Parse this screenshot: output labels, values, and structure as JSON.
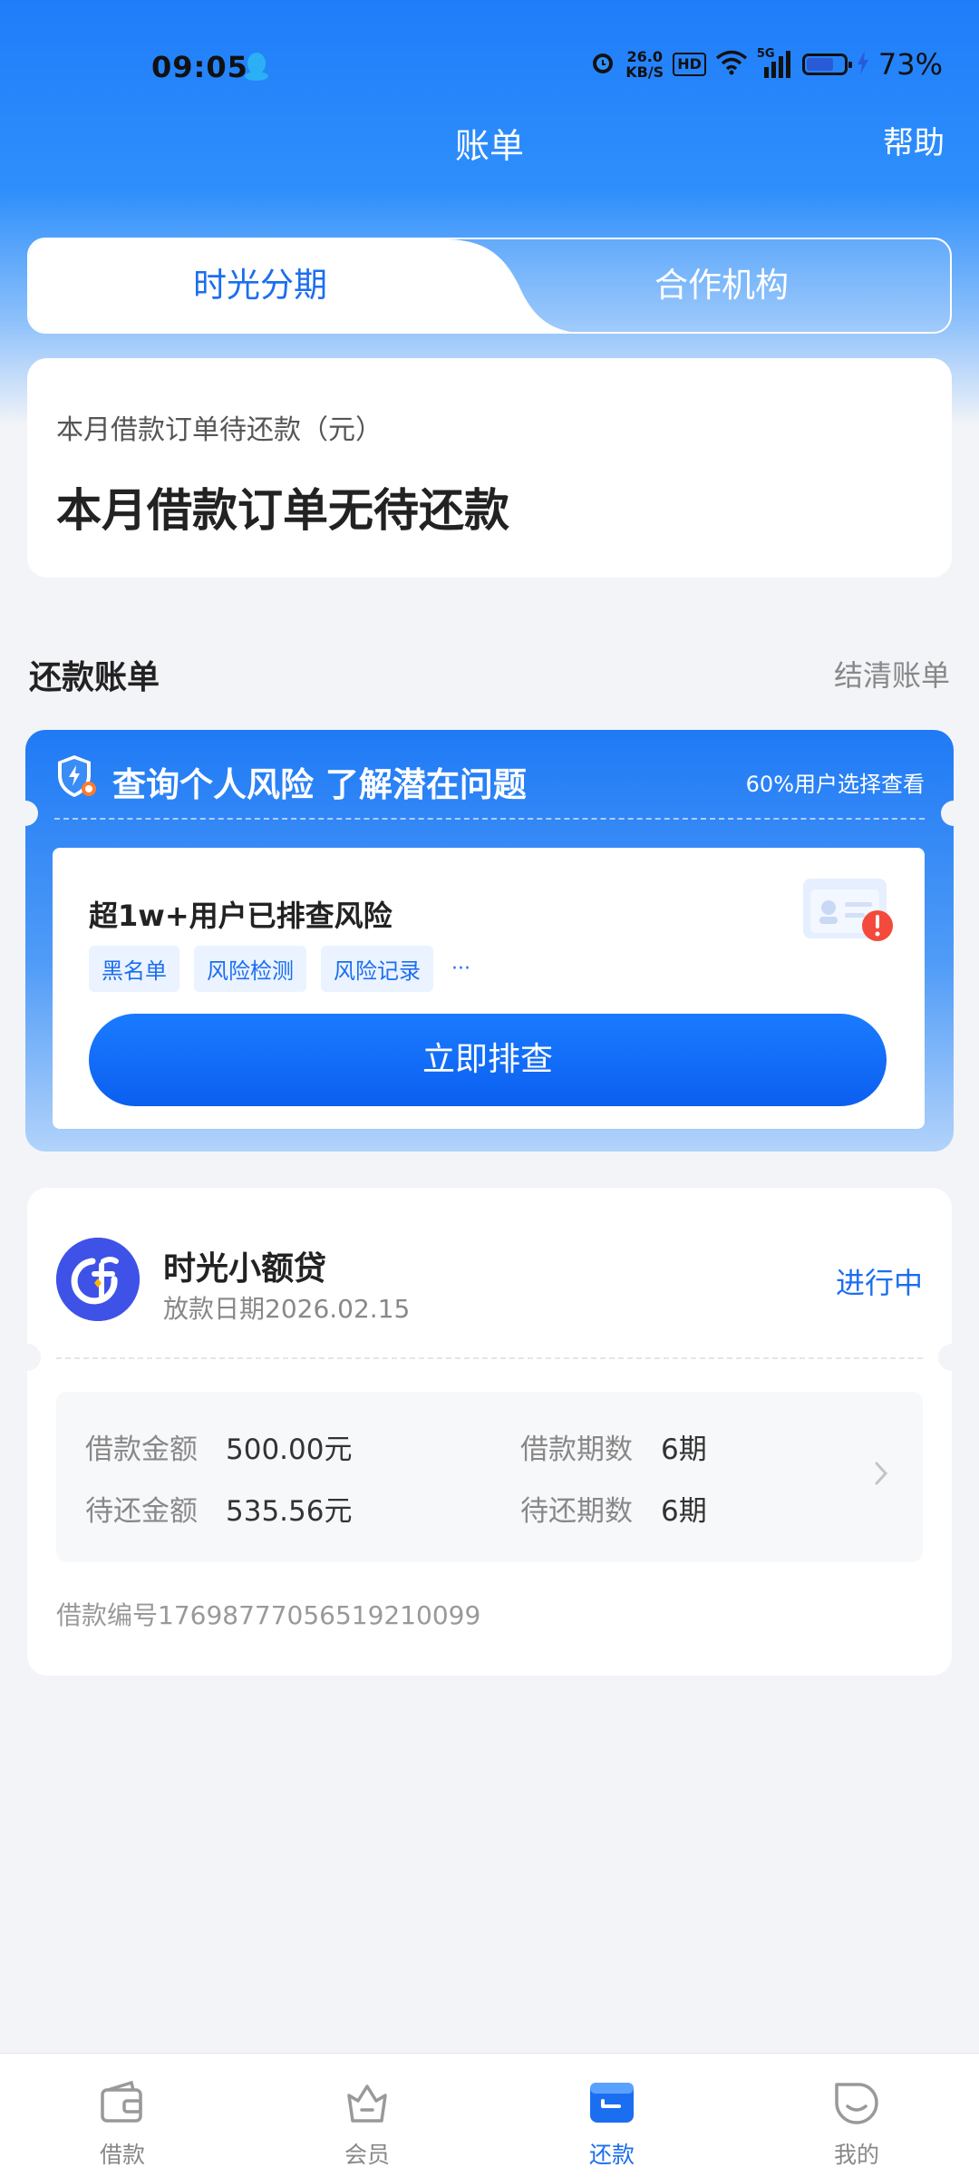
{
  "status_bar": {
    "time": "09:05",
    "net_speed": "26.0",
    "net_unit": "KB/S",
    "hd": "HD",
    "cellular": "5G",
    "battery_level": 0.73,
    "battery_percent": "73%"
  },
  "header": {
    "title": "账单",
    "help": "帮助"
  },
  "tabs": [
    {
      "label": "时光分期",
      "active": true
    },
    {
      "label": "合作机构",
      "active": false
    }
  ],
  "monthly": {
    "label": "本月借款订单待还款（元）",
    "value": "本月借款订单无待还款"
  },
  "section": {
    "title": "还款账单",
    "link": "结清账单"
  },
  "risk": {
    "title": "查询个人风险 了解潜在问题",
    "subtitle": "60%用户选择查看",
    "inner_title": "超1w+用户已排查风险",
    "tags": [
      "黑名单",
      "风险检测",
      "风险记录"
    ],
    "more": "···",
    "button": "立即排查"
  },
  "loan": {
    "name": "时光小额贷",
    "date": "放款日期2026.02.15",
    "status": "进行中",
    "amount_label": "借款金额",
    "amount_value": "500.00元",
    "periods_label": "借款期数",
    "periods_value": "6期",
    "due_label": "待还金额",
    "due_value": "535.56元",
    "due_periods_label": "待还期数",
    "due_periods_value": "6期",
    "number": "借款编号17698777056519210099"
  },
  "nav": [
    {
      "label": "借款",
      "icon": "wallet-icon"
    },
    {
      "label": "会员",
      "icon": "crown-icon"
    },
    {
      "label": "还款",
      "icon": "repay-icon",
      "active": true
    },
    {
      "label": "我的",
      "icon": "smile-icon"
    }
  ],
  "colors": {
    "primary": "#1c6ef0",
    "background": "#f3f4f8",
    "loan_logo": "#3f52e8"
  }
}
